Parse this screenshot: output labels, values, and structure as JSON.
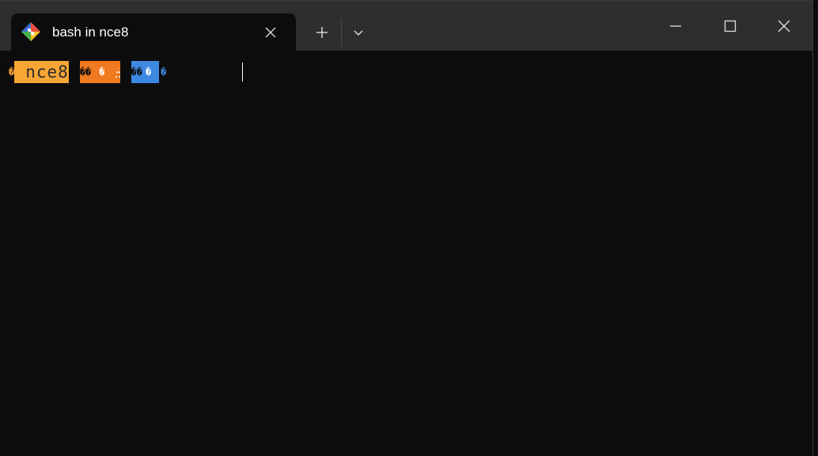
{
  "tab": {
    "title": "bash in nce8",
    "icon": "git-bash-icon"
  },
  "toolbar": {
    "new_tab_icon": "plus-icon",
    "dropdown_icon": "chevron-down-icon"
  },
  "window_controls": {
    "minimize_icon": "minimize-icon",
    "maximize_icon": "maximize-icon",
    "close_icon": "close-icon"
  },
  "prompt": {
    "lead_glyph": "�",
    "host": "nce8",
    "sep1": "��",
    "path_glyph": "�",
    "path": "~",
    "sep2": "��",
    "git_glyph": "�",
    "end_glyph": "�"
  },
  "colors": {
    "titlebar": "#2e2e2e",
    "terminal_bg": "#0c0c0c",
    "host_segment": "#f7a635",
    "path_segment": "#ef7a1f",
    "git_segment": "#3e88e4"
  }
}
